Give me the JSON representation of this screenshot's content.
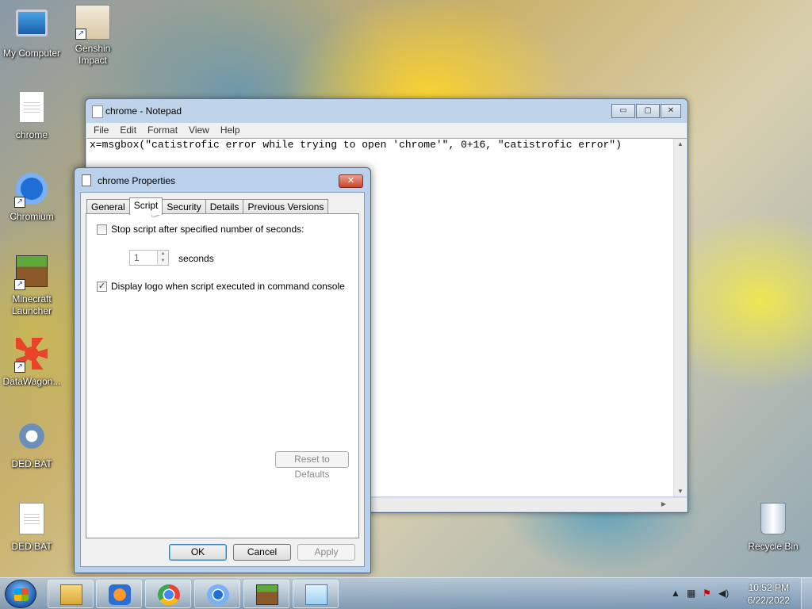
{
  "desktop": {
    "icons": [
      {
        "label": "My Computer",
        "icon": "computer-icon"
      },
      {
        "label": "Genshin Impact",
        "icon": "genshin-icon"
      },
      {
        "label": "chrome",
        "icon": "file-icon"
      },
      {
        "label": "Chromium",
        "icon": "chromium-icon"
      },
      {
        "label": "Minecraft Launcher",
        "icon": "minecraft-icon"
      },
      {
        "label": "DataWagon...",
        "icon": "datawagon-icon"
      },
      {
        "label": "DED.BAT",
        "icon": "gear-icon"
      },
      {
        "label": "DED.BAT",
        "icon": "file-icon"
      },
      {
        "label": "Recycle Bin",
        "icon": "recycle-bin-icon"
      }
    ]
  },
  "notepad": {
    "title": "chrome - Notepad",
    "menu": [
      "File",
      "Edit",
      "Format",
      "View",
      "Help"
    ],
    "content": "x=msgbox(\"catistrofic error while trying to open 'chrome'\", 0+16, \"catistrofic error\")",
    "caption": {
      "minimize": "▭",
      "maximize": "▢",
      "close": "✕"
    }
  },
  "properties": {
    "title": "chrome Properties",
    "close": "✕",
    "tabs": [
      "General",
      "Script",
      "Security",
      "Details",
      "Previous Versions"
    ],
    "active_tab": "Script",
    "stop_script_label": "Stop script after specified number of seconds:",
    "stop_script_checked": false,
    "seconds_value": "1",
    "seconds_label": "seconds",
    "display_logo_label": "Display logo when script executed in command console",
    "display_logo_checked": true,
    "check_mark": "✓",
    "reset_label": "Reset to Defaults",
    "ok_label": "OK",
    "cancel_label": "Cancel",
    "apply_label": "Apply"
  },
  "taskbar": {
    "apps": [
      "explorer-icon",
      "media-player-icon",
      "chrome-icon",
      "chromium-icon",
      "minecraft-icon",
      "notepad-icon"
    ],
    "time": "10:52 PM",
    "date": "6/22/2022"
  }
}
